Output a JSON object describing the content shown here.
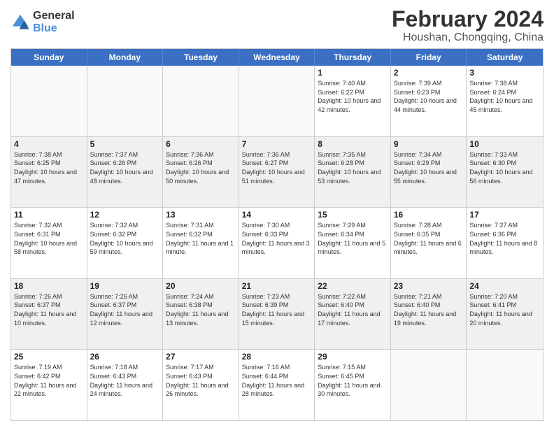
{
  "logo": {
    "general": "General",
    "blue": "Blue"
  },
  "title": "February 2024",
  "location": "Houshan, Chongqing, China",
  "header_days": [
    "Sunday",
    "Monday",
    "Tuesday",
    "Wednesday",
    "Thursday",
    "Friday",
    "Saturday"
  ],
  "rows": [
    [
      {
        "day": "",
        "info": ""
      },
      {
        "day": "",
        "info": ""
      },
      {
        "day": "",
        "info": ""
      },
      {
        "day": "",
        "info": ""
      },
      {
        "day": "1",
        "info": "Sunrise: 7:40 AM\nSunset: 6:22 PM\nDaylight: 10 hours\nand 42 minutes."
      },
      {
        "day": "2",
        "info": "Sunrise: 7:39 AM\nSunset: 6:23 PM\nDaylight: 10 hours\nand 44 minutes."
      },
      {
        "day": "3",
        "info": "Sunrise: 7:38 AM\nSunset: 6:24 PM\nDaylight: 10 hours\nand 45 minutes."
      }
    ],
    [
      {
        "day": "4",
        "info": "Sunrise: 7:38 AM\nSunset: 6:25 PM\nDaylight: 10 hours\nand 47 minutes."
      },
      {
        "day": "5",
        "info": "Sunrise: 7:37 AM\nSunset: 6:26 PM\nDaylight: 10 hours\nand 48 minutes."
      },
      {
        "day": "6",
        "info": "Sunrise: 7:36 AM\nSunset: 6:26 PM\nDaylight: 10 hours\nand 50 minutes."
      },
      {
        "day": "7",
        "info": "Sunrise: 7:36 AM\nSunset: 6:27 PM\nDaylight: 10 hours\nand 51 minutes."
      },
      {
        "day": "8",
        "info": "Sunrise: 7:35 AM\nSunset: 6:28 PM\nDaylight: 10 hours\nand 53 minutes."
      },
      {
        "day": "9",
        "info": "Sunrise: 7:34 AM\nSunset: 6:29 PM\nDaylight: 10 hours\nand 55 minutes."
      },
      {
        "day": "10",
        "info": "Sunrise: 7:33 AM\nSunset: 6:30 PM\nDaylight: 10 hours\nand 56 minutes."
      }
    ],
    [
      {
        "day": "11",
        "info": "Sunrise: 7:32 AM\nSunset: 6:31 PM\nDaylight: 10 hours\nand 58 minutes."
      },
      {
        "day": "12",
        "info": "Sunrise: 7:32 AM\nSunset: 6:32 PM\nDaylight: 10 hours\nand 59 minutes."
      },
      {
        "day": "13",
        "info": "Sunrise: 7:31 AM\nSunset: 6:32 PM\nDaylight: 11 hours\nand 1 minute."
      },
      {
        "day": "14",
        "info": "Sunrise: 7:30 AM\nSunset: 6:33 PM\nDaylight: 11 hours\nand 3 minutes."
      },
      {
        "day": "15",
        "info": "Sunrise: 7:29 AM\nSunset: 6:34 PM\nDaylight: 11 hours\nand 5 minutes."
      },
      {
        "day": "16",
        "info": "Sunrise: 7:28 AM\nSunset: 6:35 PM\nDaylight: 11 hours\nand 6 minutes."
      },
      {
        "day": "17",
        "info": "Sunrise: 7:27 AM\nSunset: 6:36 PM\nDaylight: 11 hours\nand 8 minutes."
      }
    ],
    [
      {
        "day": "18",
        "info": "Sunrise: 7:26 AM\nSunset: 6:37 PM\nDaylight: 11 hours\nand 10 minutes."
      },
      {
        "day": "19",
        "info": "Sunrise: 7:25 AM\nSunset: 6:37 PM\nDaylight: 11 hours\nand 12 minutes."
      },
      {
        "day": "20",
        "info": "Sunrise: 7:24 AM\nSunset: 6:38 PM\nDaylight: 11 hours\nand 13 minutes."
      },
      {
        "day": "21",
        "info": "Sunrise: 7:23 AM\nSunset: 6:39 PM\nDaylight: 11 hours\nand 15 minutes."
      },
      {
        "day": "22",
        "info": "Sunrise: 7:22 AM\nSunset: 6:40 PM\nDaylight: 11 hours\nand 17 minutes."
      },
      {
        "day": "23",
        "info": "Sunrise: 7:21 AM\nSunset: 6:40 PM\nDaylight: 11 hours\nand 19 minutes."
      },
      {
        "day": "24",
        "info": "Sunrise: 7:20 AM\nSunset: 6:41 PM\nDaylight: 11 hours\nand 20 minutes."
      }
    ],
    [
      {
        "day": "25",
        "info": "Sunrise: 7:19 AM\nSunset: 6:42 PM\nDaylight: 11 hours\nand 22 minutes."
      },
      {
        "day": "26",
        "info": "Sunrise: 7:18 AM\nSunset: 6:43 PM\nDaylight: 11 hours\nand 24 minutes."
      },
      {
        "day": "27",
        "info": "Sunrise: 7:17 AM\nSunset: 6:43 PM\nDaylight: 11 hours\nand 26 minutes."
      },
      {
        "day": "28",
        "info": "Sunrise: 7:16 AM\nSunset: 6:44 PM\nDaylight: 11 hours\nand 28 minutes."
      },
      {
        "day": "29",
        "info": "Sunrise: 7:15 AM\nSunset: 6:45 PM\nDaylight: 11 hours\nand 30 minutes."
      },
      {
        "day": "",
        "info": ""
      },
      {
        "day": "",
        "info": ""
      }
    ]
  ]
}
